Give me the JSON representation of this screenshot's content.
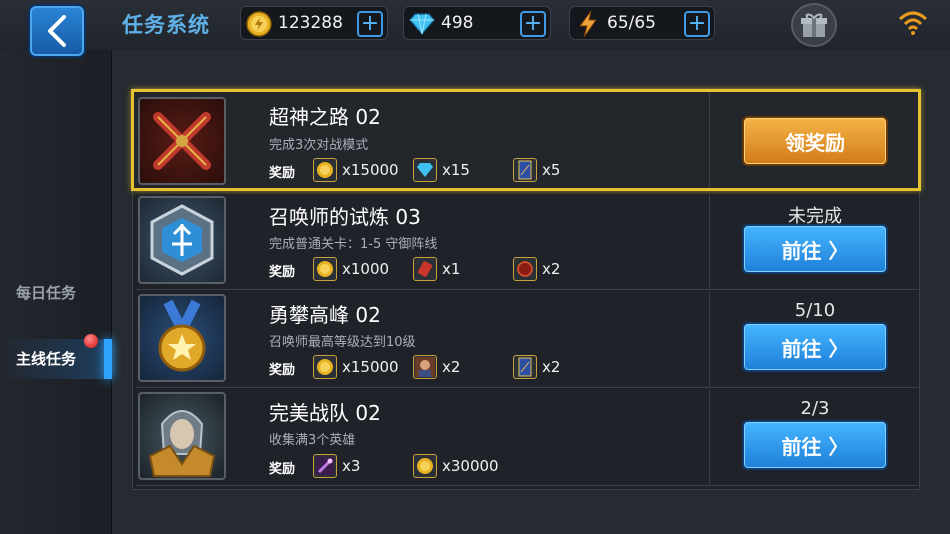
{
  "header": {
    "title": "任务系统",
    "gold": "123288",
    "diamonds": "498",
    "energy": "65/65",
    "plus_symbol": "+"
  },
  "tabs": {
    "daily": "每日任务",
    "main": "主线任务"
  },
  "reward_label": "奖励",
  "tasks": [
    {
      "name": "超神之路 02",
      "desc": "完成3次对战模式",
      "rewards": [
        {
          "icon": "gold-coin-icon",
          "count": "x15000"
        },
        {
          "icon": "diamond-icon",
          "count": "x15"
        },
        {
          "icon": "card-icon",
          "count": "x5"
        }
      ],
      "action": "领奖励"
    },
    {
      "name": "召唤师的试炼 03",
      "desc": "完成普通关卡：1-5 守御阵线",
      "status": "未完成",
      "rewards": [
        {
          "icon": "gold-coin-icon",
          "count": "x1000"
        },
        {
          "icon": "scroll-icon",
          "count": "x1"
        },
        {
          "icon": "orb-icon",
          "count": "x2"
        }
      ],
      "action": "前往 〉"
    },
    {
      "name": "勇攀高峰 02",
      "desc": "召唤师最高等级达到10级",
      "status": "5/10",
      "rewards": [
        {
          "icon": "gold-coin-icon",
          "count": "x15000"
        },
        {
          "icon": "hero-portrait-icon",
          "count": "x2"
        },
        {
          "icon": "card-icon",
          "count": "x2"
        }
      ],
      "action": "前往 〉"
    },
    {
      "name": "完美战队 02",
      "desc": "收集满3个英雄",
      "status": "2/3",
      "rewards": [
        {
          "icon": "wand-icon",
          "count": "x3"
        },
        {
          "icon": "gold-coin-icon",
          "count": "x30000"
        }
      ],
      "action": "前往 〉"
    }
  ]
}
